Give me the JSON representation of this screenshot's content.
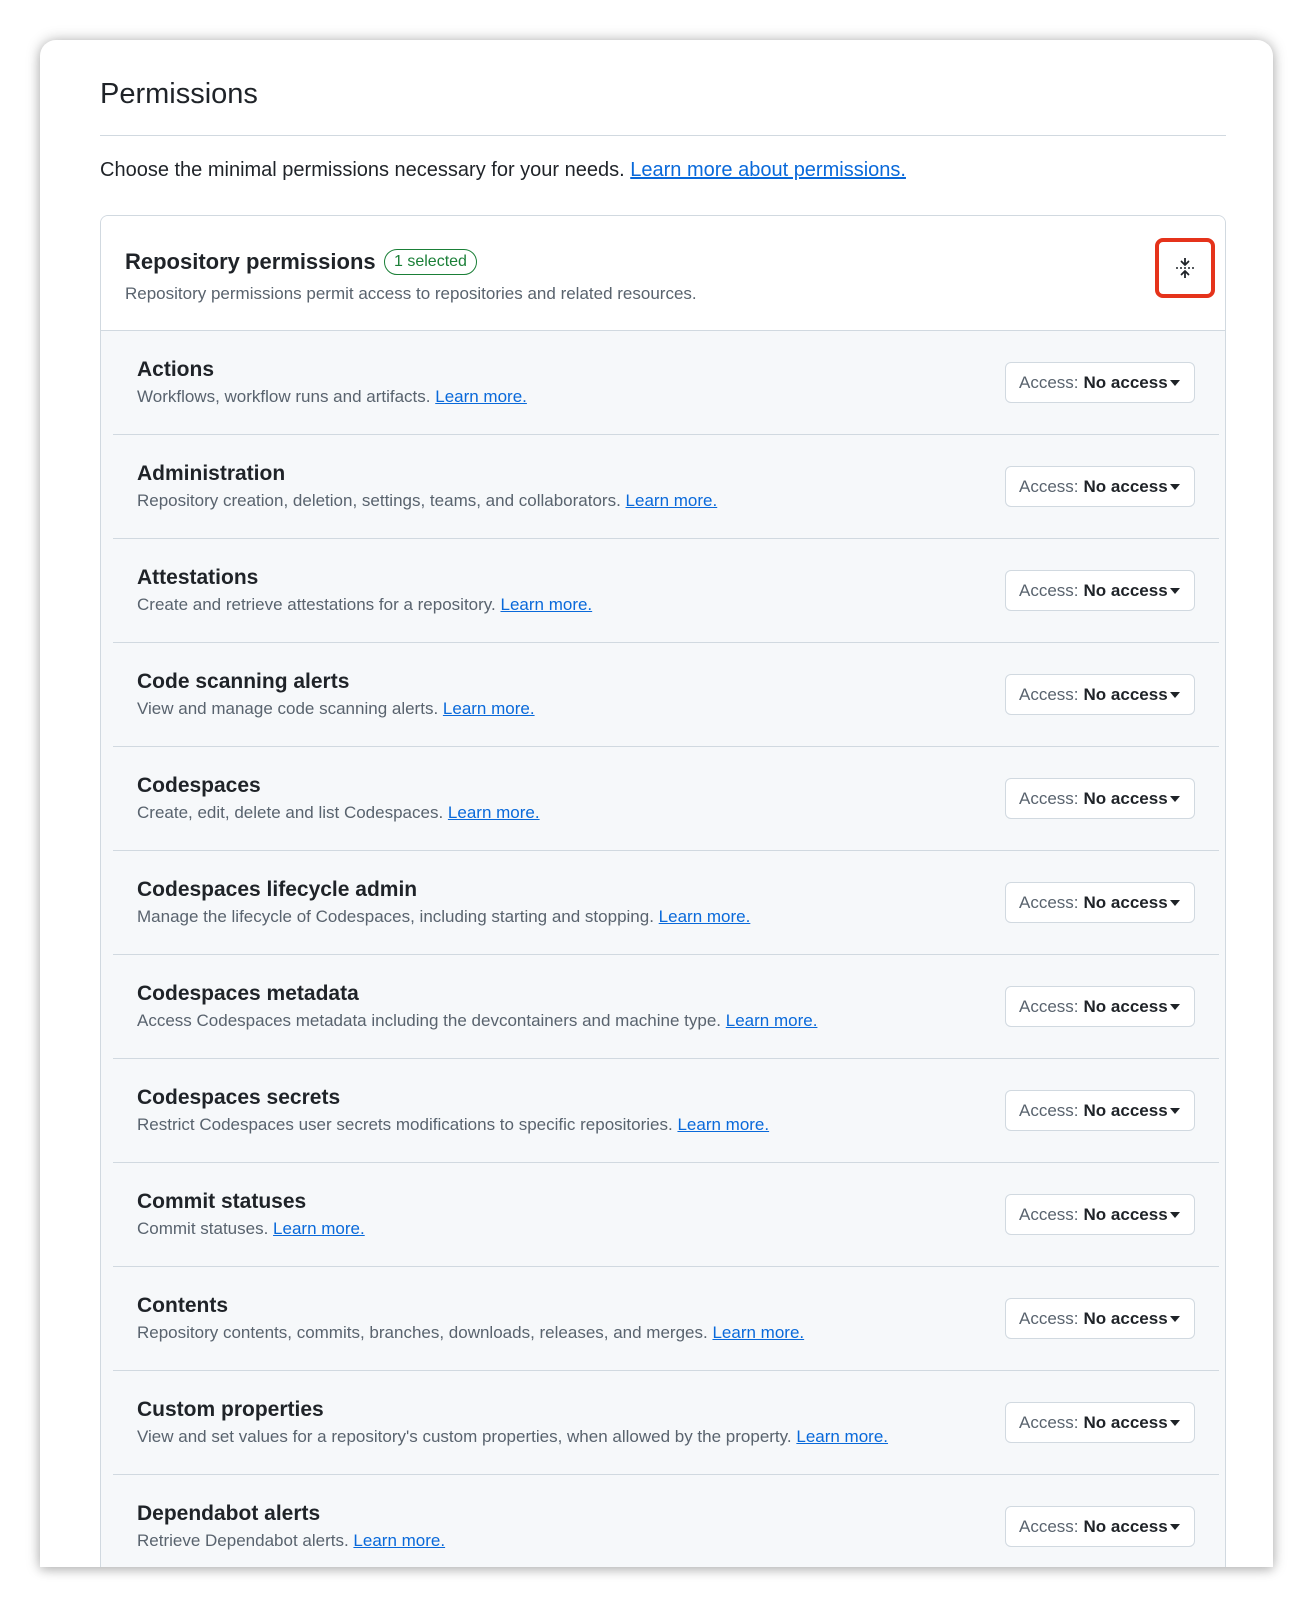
{
  "page": {
    "title": "Permissions",
    "intro_text": "Choose the minimal permissions necessary for your needs.",
    "intro_link": "Learn more about permissions."
  },
  "repository_permissions": {
    "title": "Repository permissions",
    "badge": "1 selected",
    "subtitle": "Repository permissions permit access to repositories and related resources.",
    "collapse_icon": "fold-icon",
    "access_prefix": "Access:",
    "learn_more": "Learn more.",
    "items": [
      {
        "name": "Actions",
        "description": "Workflows, workflow runs and artifacts.",
        "link": "Learn more.",
        "access": "No access"
      },
      {
        "name": "Administration",
        "description": "Repository creation, deletion, settings, teams, and collaborators.",
        "link": "Learn more.",
        "access": "No access"
      },
      {
        "name": "Attestations",
        "description": "Create and retrieve attestations for a repository.",
        "link": "Learn more.",
        "access": "No access"
      },
      {
        "name": "Code scanning alerts",
        "description": "View and manage code scanning alerts.",
        "link": "Learn more.",
        "access": "No access"
      },
      {
        "name": "Codespaces",
        "description": "Create, edit, delete and list Codespaces.",
        "link": "Learn more.",
        "access": "No access"
      },
      {
        "name": "Codespaces lifecycle admin",
        "description": "Manage the lifecycle of Codespaces, including starting and stopping.",
        "link": "Learn more.",
        "access": "No access"
      },
      {
        "name": "Codespaces metadata",
        "description": "Access Codespaces metadata including the devcontainers and machine type.",
        "link": "Learn more.",
        "access": "No access"
      },
      {
        "name": "Codespaces secrets",
        "description": "Restrict Codespaces user secrets modifications to specific repositories.",
        "link": "Learn more.",
        "access": "No access"
      },
      {
        "name": "Commit statuses",
        "description": "Commit statuses.",
        "link": "Learn more.",
        "access": "No access"
      },
      {
        "name": "Contents",
        "description": "Repository contents, commits, branches, downloads, releases, and merges.",
        "link": "Learn more.",
        "access": "No access"
      },
      {
        "name": "Custom properties",
        "description": "View and set values for a repository's custom properties, when allowed by the property.",
        "link": "Learn more.",
        "access": "No access"
      },
      {
        "name": "Dependabot alerts",
        "description": "Retrieve Dependabot alerts.",
        "link": "Learn more.",
        "access": "No access"
      }
    ]
  },
  "colors": {
    "accent_link": "#0969da",
    "badge_green": "#1a7f37",
    "highlight_red": "#e5331b",
    "border": "#d1d9e0",
    "muted_text": "#59636e"
  }
}
